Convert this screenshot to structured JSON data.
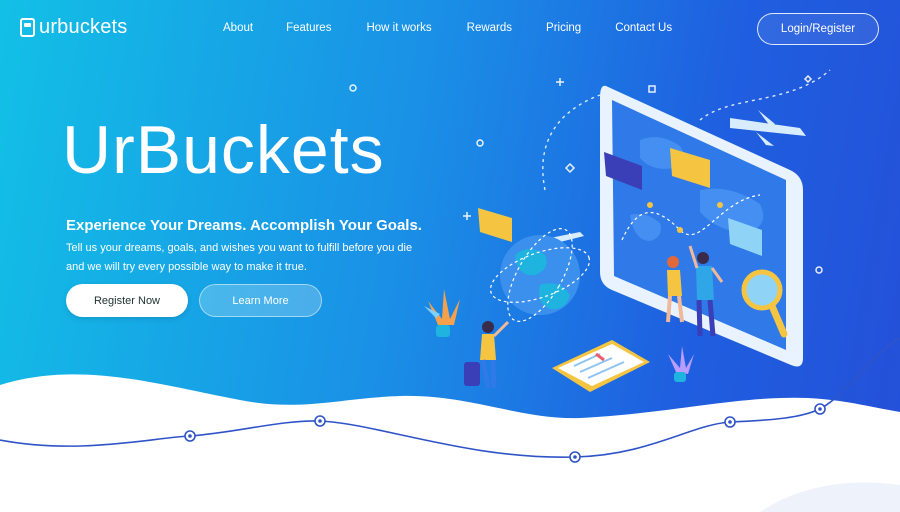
{
  "nav": {
    "logo_text": "urbuckets",
    "links": [
      "About",
      "Features",
      "How it works",
      "Rewards",
      "Pricing",
      "Contact Us"
    ],
    "login_label": "Login/Register"
  },
  "hero": {
    "title": "UrBuckets",
    "subtitle": "Experience Your Dreams. Accomplish Your Goals.",
    "description": "Tell us your dreams, goals, and wishes you want to fulfill before you die and we will try every possible way to make it true.",
    "register_label": "Register Now",
    "learn_label": "Learn More"
  },
  "colors": {
    "gradient_start": "#12c0e6",
    "gradient_end": "#2450d8",
    "wave_line": "#2f54c8",
    "accent_yellow": "#f5c542"
  },
  "icons": [
    "logo-bucket-icon",
    "airplane-icon",
    "globe-icon",
    "magnifier-icon",
    "chat-bubble-icon",
    "clipboard-icon",
    "plant-icon"
  ]
}
